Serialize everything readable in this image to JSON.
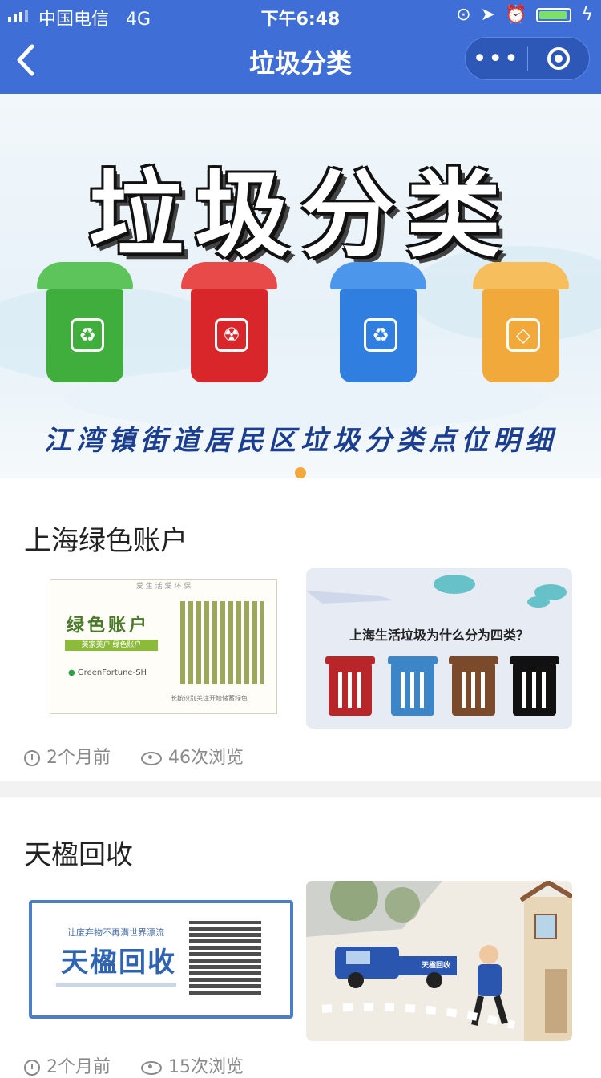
{
  "status": {
    "carrier": "中国电信",
    "network": "4G",
    "time": "下午6:48"
  },
  "nav": {
    "back_icon": "‹",
    "title": "垃圾分类",
    "more_label": "•••"
  },
  "banner": {
    "title": "垃圾分类",
    "subtitle": "江湾镇街道居民区垃圾分类点位明细",
    "bins": [
      {
        "color": "#3fae3c",
        "lid": "#5cc45a",
        "symbol": "♻"
      },
      {
        "color": "#d8262b",
        "lid": "#e84a4a",
        "symbol": "☢"
      },
      {
        "color": "#2f7ee0",
        "lid": "#4c96ec",
        "symbol": "♻"
      },
      {
        "color": "#f2a93c",
        "lid": "#f7be5e",
        "symbol": "◇"
      }
    ]
  },
  "sections": [
    {
      "title": "上海绿色账户",
      "card_left": {
        "top_text": "爱 生 活 爱 环 保",
        "heading": "绿色账户",
        "tagline": "美家美户 绿色账户",
        "brand": "GreenFortune-SH",
        "qr_caption": "长按识别关注开始储蓄绿色"
      },
      "card_right": {
        "heading": "上海生活垃圾为什么分为四类？"
      },
      "time": "2个月前",
      "views": "46次浏览"
    },
    {
      "title": "天楹回收",
      "card_left": {
        "top_text": "让废弃物不再满世界漂流",
        "heading": "天楹回收"
      },
      "card_right": {
        "truck_label": "天楹回收"
      },
      "time": "2个月前",
      "views": "15次浏览"
    }
  ]
}
